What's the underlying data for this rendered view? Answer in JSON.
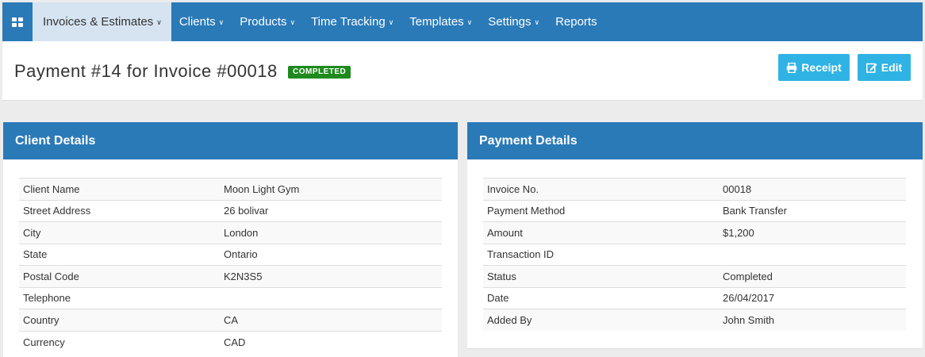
{
  "nav": {
    "home_icon": "grid-icon",
    "items": [
      {
        "label": "Invoices & Estimates",
        "active": true
      },
      {
        "label": "Clients"
      },
      {
        "label": "Products"
      },
      {
        "label": "Time Tracking"
      },
      {
        "label": "Templates"
      },
      {
        "label": "Settings"
      },
      {
        "label": "Reports"
      }
    ],
    "colors": {
      "bar": "#2a7ab8",
      "active": "#d6e4f2"
    }
  },
  "header": {
    "title": "Payment #14 for Invoice #00018",
    "status": "COMPLETED",
    "status_color": "#1e8a1e",
    "buttons": {
      "receipt": {
        "label": "Receipt",
        "icon": "print-icon"
      },
      "edit": {
        "label": "Edit",
        "icon": "edit-icon"
      }
    },
    "button_color": "#2fb3e4"
  },
  "client_details": {
    "heading": "Client Details",
    "rows": [
      {
        "label": "Client Name",
        "value": "Moon Light Gym"
      },
      {
        "label": "Street Address",
        "value": "26 bolivar"
      },
      {
        "label": "City",
        "value": "London"
      },
      {
        "label": "State",
        "value": "Ontario"
      },
      {
        "label": "Postal Code",
        "value": "K2N3S5"
      },
      {
        "label": "Telephone",
        "value": ""
      },
      {
        "label": "Country",
        "value": "CA"
      },
      {
        "label": "Currency",
        "value": "CAD"
      }
    ]
  },
  "payment_details": {
    "heading": "Payment Details",
    "rows": [
      {
        "label": "Invoice No.",
        "value": "00018"
      },
      {
        "label": "Payment Method",
        "value": "Bank Transfer"
      },
      {
        "label": "Amount",
        "value": "$1,200"
      },
      {
        "label": "Transaction ID",
        "value": ""
      },
      {
        "label": "Status",
        "value": "Completed"
      },
      {
        "label": "Date",
        "value": "26/04/2017"
      },
      {
        "label": "Added By",
        "value": "John Smith"
      }
    ]
  }
}
